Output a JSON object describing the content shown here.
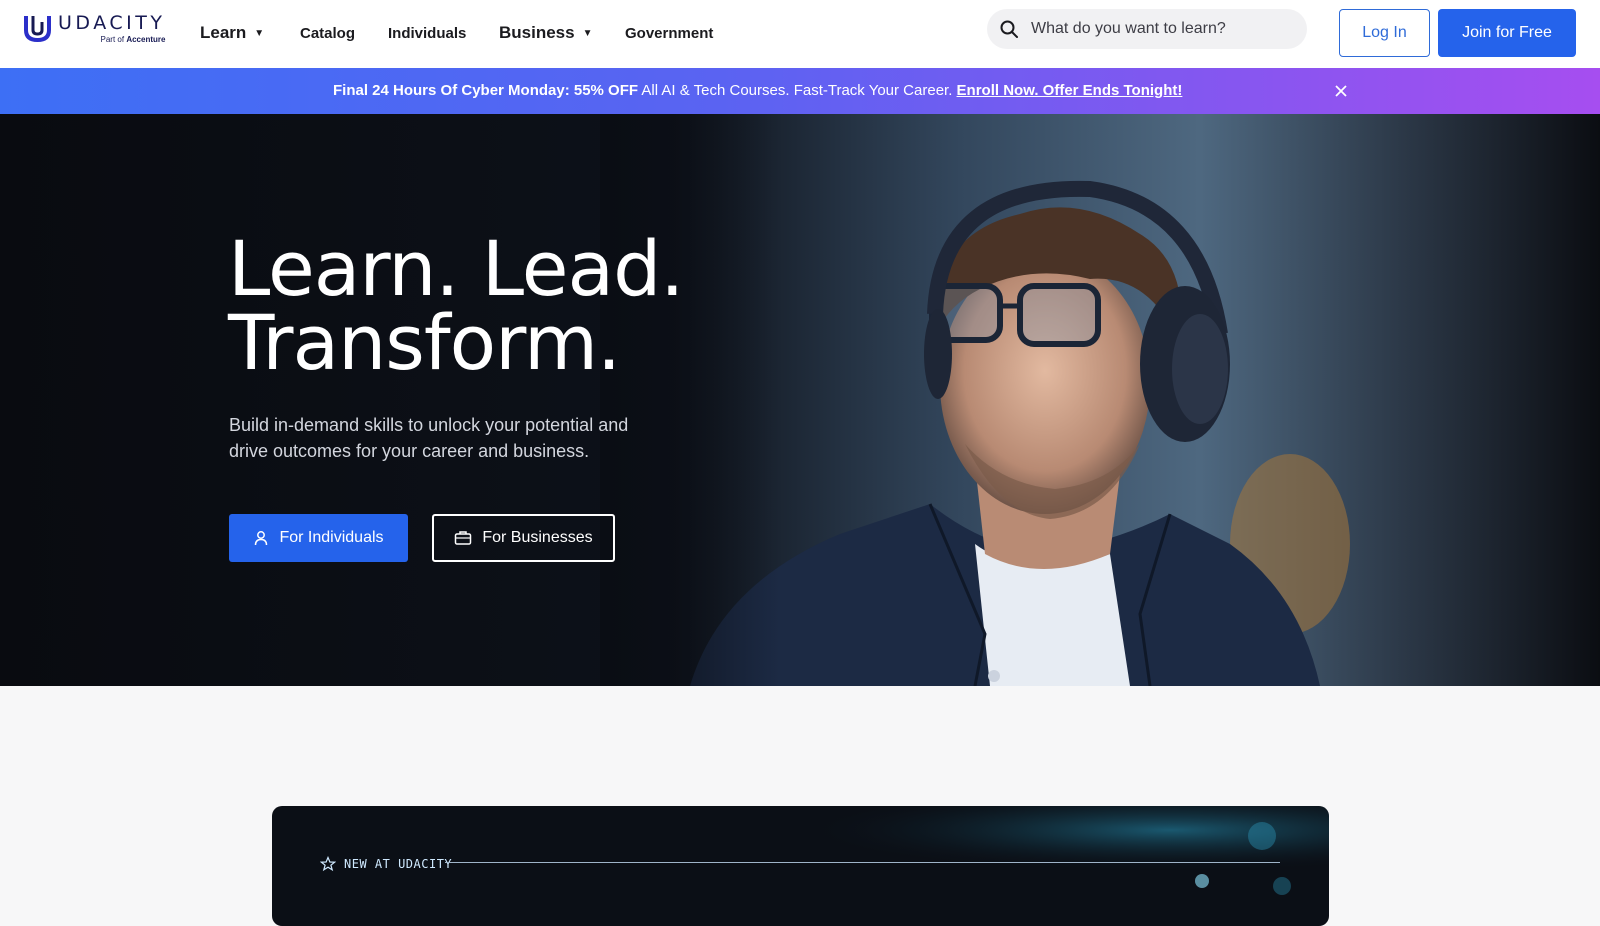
{
  "logo": {
    "wordmark": "UDACITY",
    "sub_prefix": "Part of",
    "sub_brand": "Accenture"
  },
  "nav": {
    "learn": "Learn",
    "catalog": "Catalog",
    "individuals": "Individuals",
    "business": "Business",
    "government": "Government"
  },
  "search": {
    "placeholder": "What do you want to learn?"
  },
  "auth": {
    "login": "Log In",
    "join": "Join for Free"
  },
  "promo": {
    "bold": "Final 24 Hours Of Cyber Monday: 55% OFF",
    "text": "All AI & Tech Courses. Fast-Track Your Career.",
    "link": "Enroll Now. Offer Ends Tonight!"
  },
  "hero": {
    "title_line1": "Learn. Lead.",
    "title_line2": "Transform.",
    "subtitle": "Build in-demand skills to unlock your potential and drive outcomes for your career and business.",
    "btn_individuals": "For Individuals",
    "btn_businesses": "For Businesses"
  },
  "new_section": {
    "label": "NEW AT UDACITY"
  },
  "colors": {
    "brand_blue": "#2563eb",
    "logo_navy": "#171a53",
    "hero_bg": "#0a0d14"
  }
}
